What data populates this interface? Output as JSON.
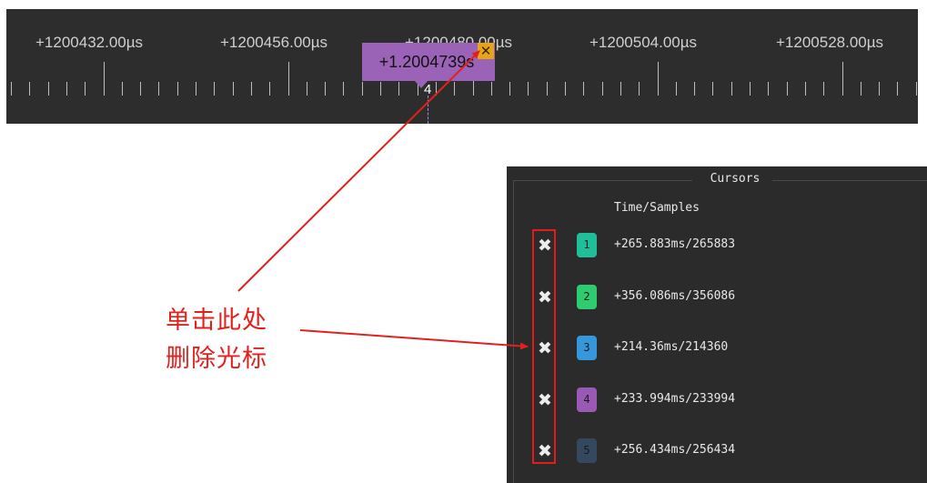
{
  "timeline": {
    "tick_labels": [
      "+1200432.00µs",
      "+1200456.00µs",
      "+1200480.00µs",
      "+1200504.00µs",
      "+1200528.00µs"
    ],
    "cursor_flag": {
      "time_label": "+1.2004739s",
      "number": "4",
      "color": "#9b63b8",
      "close_glyph": "✕"
    }
  },
  "cursors_panel": {
    "title": "Cursors",
    "column_header": "Time/Samples",
    "delete_glyph": "✖",
    "rows": [
      {
        "number": "1",
        "value": "+265.883ms/265883",
        "color": "#1fbf9a"
      },
      {
        "number": "2",
        "value": "+356.086ms/356086",
        "color": "#2ecc71"
      },
      {
        "number": "3",
        "value": "+214.36ms/214360",
        "color": "#3498db"
      },
      {
        "number": "4",
        "value": "+233.994ms/233994",
        "color": "#9b59b6"
      },
      {
        "number": "5",
        "value": "+256.434ms/256434",
        "color": "#34495e"
      }
    ]
  },
  "annotation": {
    "line1": "单击此处",
    "line2": "删除光标",
    "color": "#e3211c"
  }
}
